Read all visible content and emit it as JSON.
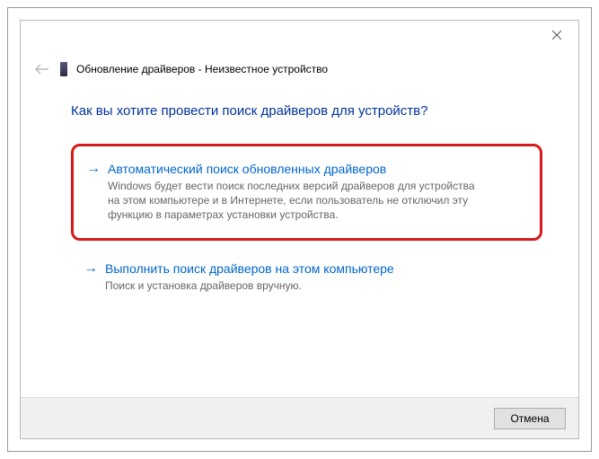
{
  "header": {
    "title": "Обновление драйверов - Неизвестное устройство"
  },
  "content": {
    "question": "Как вы хотите провести поиск драйверов для устройств?",
    "options": [
      {
        "title": "Автоматический поиск обновленных драйверов",
        "description": "Windows будет вести поиск последних версий драйверов для устройства на этом компьютере и в Интернете, если пользователь не отключил эту функцию в параметрах установки устройства."
      },
      {
        "title": "Выполнить поиск драйверов на этом компьютере",
        "description": "Поиск и установка драйверов вручную."
      }
    ]
  },
  "footer": {
    "cancel_label": "Отмена"
  }
}
